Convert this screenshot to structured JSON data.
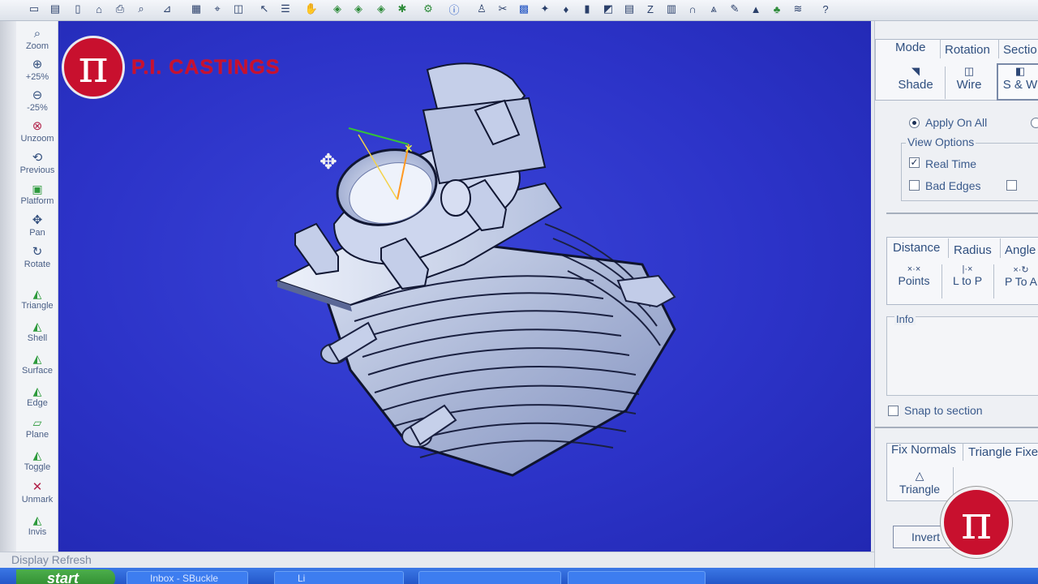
{
  "logo": {
    "symbol": "π",
    "name": "P.I. CASTINGS"
  },
  "left_tools": [
    {
      "label": "Zoom",
      "icon": "zoom-icon",
      "glyph": "⌕"
    },
    {
      "label": "+25%",
      "icon": "zoom-in-icon",
      "glyph": "⊕"
    },
    {
      "label": "-25%",
      "icon": "zoom-out-icon",
      "glyph": "⊖"
    },
    {
      "label": "Unzoom",
      "icon": "unzoom-icon",
      "glyph": "⊗"
    },
    {
      "label": "Previous",
      "icon": "previous-view-icon",
      "glyph": "⟲"
    },
    {
      "label": "Platform",
      "icon": "platform-icon",
      "glyph": "▣"
    },
    {
      "label": "Pan",
      "icon": "pan-icon",
      "glyph": "✥"
    },
    {
      "label": "Rotate",
      "icon": "rotate-icon",
      "glyph": "↻"
    },
    {
      "label": "Triangle",
      "icon": "triangle-select-icon",
      "glyph": "◭"
    },
    {
      "label": "Shell",
      "icon": "shell-select-icon",
      "glyph": "◭"
    },
    {
      "label": "Surface",
      "icon": "surface-select-icon",
      "glyph": "◭"
    },
    {
      "label": "Edge",
      "icon": "edge-select-icon",
      "glyph": "◭"
    },
    {
      "label": "Plane",
      "icon": "plane-select-icon",
      "glyph": "▱"
    },
    {
      "label": "Toggle",
      "icon": "toggle-icon",
      "glyph": "◭"
    },
    {
      "label": "Unmark",
      "icon": "unmark-icon",
      "glyph": "✕"
    },
    {
      "label": "Invis",
      "icon": "invis-icon",
      "glyph": "◭"
    }
  ],
  "right_panel": {
    "mode_tabs": [
      "Mode",
      "Rotation",
      "Sectio"
    ],
    "display_buttons": [
      {
        "label": "Shade",
        "glyph": "◥"
      },
      {
        "label": "Wire",
        "glyph": "◫"
      },
      {
        "label": "S & W",
        "glyph": "◧"
      }
    ],
    "apply_on_all": "Apply On All",
    "view_options_title": "View Options",
    "real_time": "Real Time",
    "real_time_checked": true,
    "bad_edges": "Bad Edges",
    "bad_edges_checked": false,
    "measure_tabs": [
      "Distance",
      "Radius",
      "Angle"
    ],
    "measure_buttons": [
      {
        "label": "Points",
        "glyph": "×·×"
      },
      {
        "label": "L to P",
        "glyph": "|·×"
      },
      {
        "label": "P To A",
        "glyph": "×·↻"
      }
    ],
    "info_title": "Info",
    "snap_to_section": "Snap to section",
    "fix_tabs": [
      "Fix Normals",
      "Triangle Fixe"
    ],
    "triangle_button": "Triangle",
    "invert_button": "Invert"
  },
  "status_bar": {
    "text": "Display Refresh"
  },
  "taskbar": {
    "start": "start",
    "items": [
      "Inbox - SBuckle",
      "Li",
      "",
      ""
    ]
  },
  "badge": {
    "symbol": "π"
  }
}
